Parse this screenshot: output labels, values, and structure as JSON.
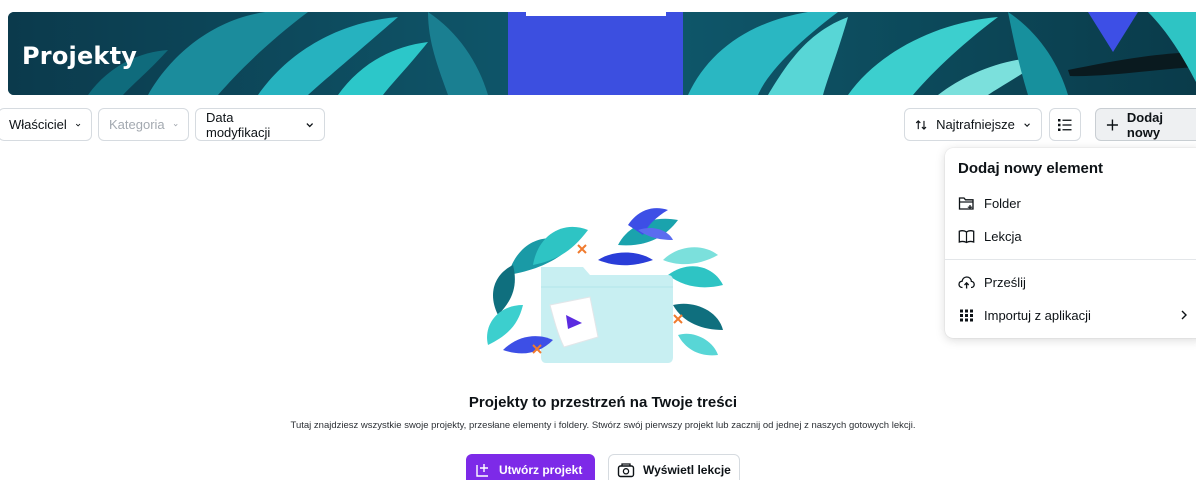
{
  "banner": {
    "title": "Projekty"
  },
  "filters": {
    "owner": "Właściciel",
    "category": "Kategoria",
    "modified": "Data modyfikacji"
  },
  "toolbar": {
    "sort_label": "Najtrafniejsze",
    "add_new_label": "Dodaj nowy"
  },
  "menu": {
    "title": "Dodaj nowy element",
    "items": [
      {
        "label": "Folder",
        "icon": "folder-plus-icon"
      },
      {
        "label": "Lekcja",
        "icon": "book-icon"
      },
      {
        "label": "Prześlij",
        "icon": "cloud-upload-icon"
      },
      {
        "label": "Importuj z aplikacji",
        "icon": "grid-apps-icon"
      }
    ]
  },
  "empty_state": {
    "title": "Projekty to przestrzeń na Twoje treści",
    "description": "Tutaj znajdziesz wszystkie swoje projekty, przesłane elementy i foldery. Stwórz swój pierwszy projekt lub zacznij od jednej z naszych gotowych lekcji.",
    "create_button": "Utwórz projekt",
    "lessons_button": "Wyświetl lekcje"
  },
  "colors": {
    "accent": "#7d2ae8",
    "banner_dark": "#0d3f52",
    "leaf_teal": "#2ec4c4",
    "folder": "#c8eff2"
  }
}
